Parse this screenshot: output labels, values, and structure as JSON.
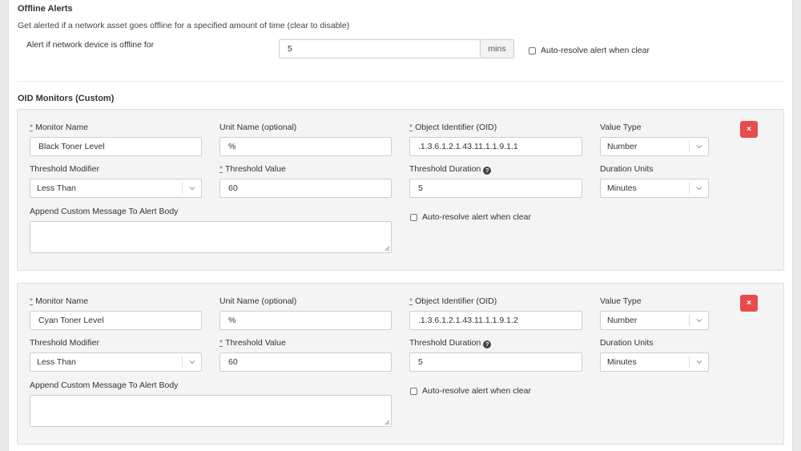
{
  "offline": {
    "title": "Offline Alerts",
    "description": "Get alerted if a network asset goes offline for a specified amount of time (clear to disable)",
    "field_label": "Alert if network device is offline for",
    "value": "5",
    "unit": "mins",
    "auto_resolve_label": "Auto-resolve alert when clear"
  },
  "oid": {
    "title": "OID Monitors (Custom)",
    "labels": {
      "required_marker": "*",
      "monitor_name": "Monitor Name",
      "unit_name": "Unit Name (optional)",
      "oid": "Object Identifier (OID)",
      "value_type": "Value Type",
      "threshold_modifier": "Threshold Modifier",
      "threshold_value": "Threshold Value",
      "threshold_duration": "Threshold Duration",
      "duration_units": "Duration Units",
      "custom_message": "Append Custom Message To Alert Body",
      "auto_resolve": "Auto-resolve alert when clear",
      "delete": "×",
      "help": "?"
    },
    "monitors": [
      {
        "monitor_name": "Black Toner Level",
        "unit_name": "%",
        "oid": ".1.3.6.1.2.1.43.11.1.1.9.1.1",
        "value_type": "Number",
        "threshold_modifier": "Less Than",
        "threshold_value": "60",
        "threshold_duration": "5",
        "duration_units": "Minutes",
        "custom_message": ""
      },
      {
        "monitor_name": "Cyan Toner Level",
        "unit_name": "%",
        "oid": ".1.3.6.1.2.1.43.11.1.1.9.1.2",
        "value_type": "Number",
        "threshold_modifier": "Less Than",
        "threshold_value": "60",
        "threshold_duration": "5",
        "duration_units": "Minutes",
        "custom_message": ""
      }
    ]
  },
  "colors": {
    "delete_button": "#e74c4c",
    "panel_background": "#f4f4f4",
    "page_background": "#e9e9ea"
  }
}
